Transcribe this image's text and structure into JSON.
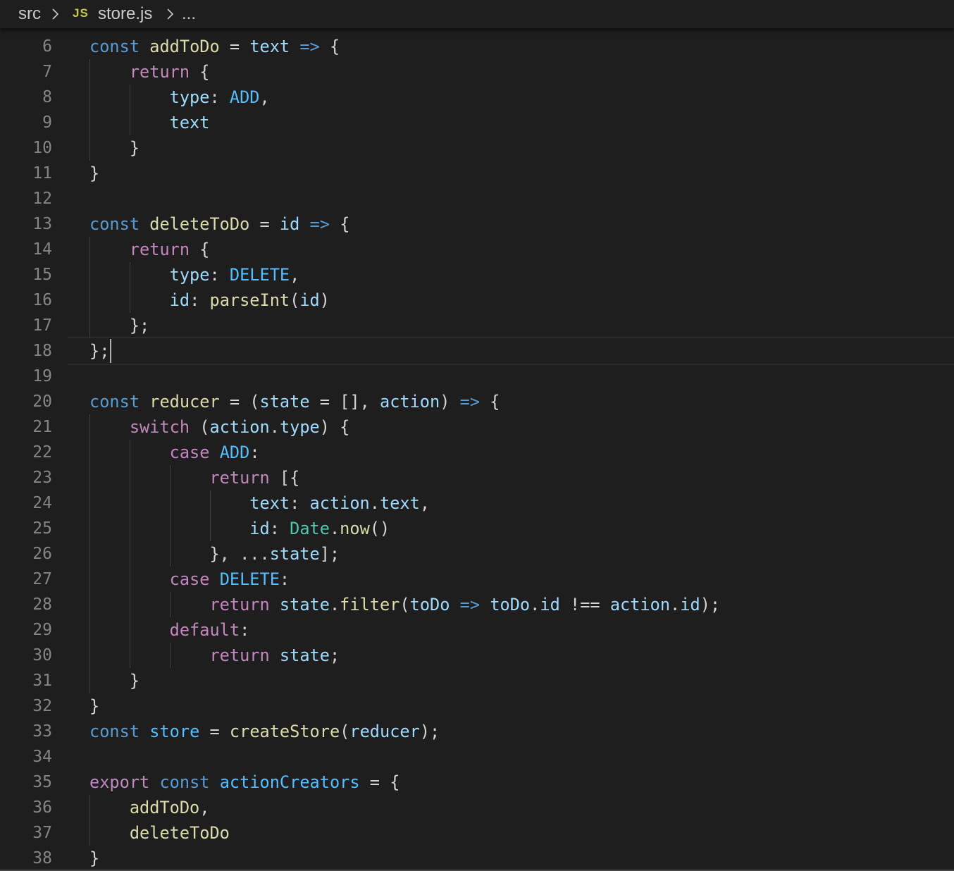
{
  "breadcrumb": {
    "folder": "src",
    "file_icon": "JS",
    "file": "store.js",
    "more": "..."
  },
  "editor": {
    "language": "javascript",
    "cursor": {
      "line": 18,
      "column": 3
    },
    "lines": [
      {
        "num": "6",
        "tokens": [
          [
            "kw",
            "const"
          ],
          [
            "pl",
            " "
          ],
          [
            "fn",
            "addToDo"
          ],
          [
            "pl",
            " = "
          ],
          [
            "var",
            "text"
          ],
          [
            "pl",
            " "
          ],
          [
            "kw",
            "=>"
          ],
          [
            "pl",
            " {"
          ]
        ]
      },
      {
        "num": "7",
        "tokens": [
          [
            "pl",
            "    "
          ],
          [
            "ctl",
            "return"
          ],
          [
            "pl",
            " {"
          ]
        ]
      },
      {
        "num": "8",
        "tokens": [
          [
            "pl",
            "        "
          ],
          [
            "var",
            "type"
          ],
          [
            "pl",
            ": "
          ],
          [
            "cst",
            "ADD"
          ],
          [
            "pl",
            ","
          ]
        ]
      },
      {
        "num": "9",
        "tokens": [
          [
            "pl",
            "        "
          ],
          [
            "var",
            "text"
          ]
        ]
      },
      {
        "num": "10",
        "tokens": [
          [
            "pl",
            "    }"
          ]
        ]
      },
      {
        "num": "11",
        "tokens": [
          [
            "pl",
            "}"
          ]
        ]
      },
      {
        "num": "12",
        "tokens": []
      },
      {
        "num": "13",
        "tokens": [
          [
            "kw",
            "const"
          ],
          [
            "pl",
            " "
          ],
          [
            "fn",
            "deleteToDo"
          ],
          [
            "pl",
            " = "
          ],
          [
            "var",
            "id"
          ],
          [
            "pl",
            " "
          ],
          [
            "kw",
            "=>"
          ],
          [
            "pl",
            " {"
          ]
        ]
      },
      {
        "num": "14",
        "tokens": [
          [
            "pl",
            "    "
          ],
          [
            "ctl",
            "return"
          ],
          [
            "pl",
            " {"
          ]
        ]
      },
      {
        "num": "15",
        "tokens": [
          [
            "pl",
            "        "
          ],
          [
            "var",
            "type"
          ],
          [
            "pl",
            ": "
          ],
          [
            "cst",
            "DELETE"
          ],
          [
            "pl",
            ","
          ]
        ]
      },
      {
        "num": "16",
        "tokens": [
          [
            "pl",
            "        "
          ],
          [
            "var",
            "id"
          ],
          [
            "pl",
            ": "
          ],
          [
            "fn",
            "parseInt"
          ],
          [
            "pl",
            "("
          ],
          [
            "var",
            "id"
          ],
          [
            "pl",
            ")"
          ]
        ]
      },
      {
        "num": "17",
        "tokens": [
          [
            "pl",
            "    };"
          ]
        ]
      },
      {
        "num": "18",
        "tokens": [
          [
            "pl",
            "};"
          ]
        ]
      },
      {
        "num": "19",
        "tokens": []
      },
      {
        "num": "20",
        "tokens": [
          [
            "kw",
            "const"
          ],
          [
            "pl",
            " "
          ],
          [
            "fn",
            "reducer"
          ],
          [
            "pl",
            " = ("
          ],
          [
            "var",
            "state"
          ],
          [
            "pl",
            " = [], "
          ],
          [
            "var",
            "action"
          ],
          [
            "pl",
            ") "
          ],
          [
            "kw",
            "=>"
          ],
          [
            "pl",
            " {"
          ]
        ]
      },
      {
        "num": "21",
        "tokens": [
          [
            "pl",
            "    "
          ],
          [
            "ctl",
            "switch"
          ],
          [
            "pl",
            " ("
          ],
          [
            "var",
            "action"
          ],
          [
            "pl",
            "."
          ],
          [
            "var",
            "type"
          ],
          [
            "pl",
            ") {"
          ]
        ]
      },
      {
        "num": "22",
        "tokens": [
          [
            "pl",
            "        "
          ],
          [
            "ctl",
            "case"
          ],
          [
            "pl",
            " "
          ],
          [
            "cst",
            "ADD"
          ],
          [
            "pl",
            ":"
          ]
        ]
      },
      {
        "num": "23",
        "tokens": [
          [
            "pl",
            "            "
          ],
          [
            "ctl",
            "return"
          ],
          [
            "pl",
            " [{"
          ]
        ]
      },
      {
        "num": "24",
        "tokens": [
          [
            "pl",
            "                "
          ],
          [
            "var",
            "text"
          ],
          [
            "pl",
            ": "
          ],
          [
            "var",
            "action"
          ],
          [
            "pl",
            "."
          ],
          [
            "var",
            "text"
          ],
          [
            "pl",
            ","
          ]
        ]
      },
      {
        "num": "25",
        "tokens": [
          [
            "pl",
            "                "
          ],
          [
            "var",
            "id"
          ],
          [
            "pl",
            ": "
          ],
          [
            "cls",
            "Date"
          ],
          [
            "pl",
            "."
          ],
          [
            "fn",
            "now"
          ],
          [
            "pl",
            "()"
          ]
        ]
      },
      {
        "num": "26",
        "tokens": [
          [
            "pl",
            "            }, ..."
          ],
          [
            "var",
            "state"
          ],
          [
            "pl",
            "];"
          ]
        ]
      },
      {
        "num": "27",
        "tokens": [
          [
            "pl",
            "        "
          ],
          [
            "ctl",
            "case"
          ],
          [
            "pl",
            " "
          ],
          [
            "cst",
            "DELETE"
          ],
          [
            "pl",
            ":"
          ]
        ]
      },
      {
        "num": "28",
        "tokens": [
          [
            "pl",
            "            "
          ],
          [
            "ctl",
            "return"
          ],
          [
            "pl",
            " "
          ],
          [
            "var",
            "state"
          ],
          [
            "pl",
            "."
          ],
          [
            "fn",
            "filter"
          ],
          [
            "pl",
            "("
          ],
          [
            "var",
            "toDo"
          ],
          [
            "pl",
            " "
          ],
          [
            "kw",
            "=>"
          ],
          [
            "pl",
            " "
          ],
          [
            "var",
            "toDo"
          ],
          [
            "pl",
            "."
          ],
          [
            "var",
            "id"
          ],
          [
            "pl",
            " !== "
          ],
          [
            "var",
            "action"
          ],
          [
            "pl",
            "."
          ],
          [
            "var",
            "id"
          ],
          [
            "pl",
            ");"
          ]
        ]
      },
      {
        "num": "29",
        "tokens": [
          [
            "pl",
            "        "
          ],
          [
            "ctl",
            "default"
          ],
          [
            "pl",
            ":"
          ]
        ]
      },
      {
        "num": "30",
        "tokens": [
          [
            "pl",
            "            "
          ],
          [
            "ctl",
            "return"
          ],
          [
            "pl",
            " "
          ],
          [
            "var",
            "state"
          ],
          [
            "pl",
            ";"
          ]
        ]
      },
      {
        "num": "31",
        "tokens": [
          [
            "pl",
            "    }"
          ]
        ]
      },
      {
        "num": "32",
        "tokens": [
          [
            "pl",
            "}"
          ]
        ]
      },
      {
        "num": "33",
        "tokens": [
          [
            "kw",
            "const"
          ],
          [
            "pl",
            " "
          ],
          [
            "cst",
            "store"
          ],
          [
            "pl",
            " = "
          ],
          [
            "fn",
            "createStore"
          ],
          [
            "pl",
            "("
          ],
          [
            "var",
            "reducer"
          ],
          [
            "pl",
            ");"
          ]
        ]
      },
      {
        "num": "34",
        "tokens": []
      },
      {
        "num": "35",
        "tokens": [
          [
            "ctl",
            "export"
          ],
          [
            "pl",
            " "
          ],
          [
            "kw",
            "const"
          ],
          [
            "pl",
            " "
          ],
          [
            "cst",
            "actionCreators"
          ],
          [
            "pl",
            " = {"
          ]
        ]
      },
      {
        "num": "36",
        "tokens": [
          [
            "pl",
            "    "
          ],
          [
            "fn",
            "addToDo"
          ],
          [
            "pl",
            ","
          ]
        ]
      },
      {
        "num": "37",
        "tokens": [
          [
            "pl",
            "    "
          ],
          [
            "fn",
            "deleteToDo"
          ]
        ]
      },
      {
        "num": "38",
        "tokens": [
          [
            "pl",
            "}"
          ]
        ]
      }
    ],
    "indent_guides": [
      {
        "level": 1,
        "from": 7,
        "to": 10
      },
      {
        "level": 2,
        "from": 8,
        "to": 9
      },
      {
        "level": 1,
        "from": 14,
        "to": 17
      },
      {
        "level": 2,
        "from": 15,
        "to": 16
      },
      {
        "level": 1,
        "from": 21,
        "to": 31
      },
      {
        "level": 2,
        "from": 22,
        "to": 30
      },
      {
        "level": 3,
        "from": 23,
        "to": 26
      },
      {
        "level": 4,
        "from": 24,
        "to": 25
      },
      {
        "level": 3,
        "from": 28,
        "to": 28
      },
      {
        "level": 3,
        "from": 30,
        "to": 30
      },
      {
        "level": 1,
        "from": 36,
        "to": 37
      }
    ]
  },
  "colors": {
    "background": "#1e1e1e",
    "line_number": "#858585",
    "kw": "#569cd6",
    "ctl": "#c586c0",
    "fn": "#dcdcaa",
    "var": "#9cdcfe",
    "cst": "#4fc1ff",
    "cls": "#4ec9b0",
    "pl": "#d4d4d4"
  }
}
